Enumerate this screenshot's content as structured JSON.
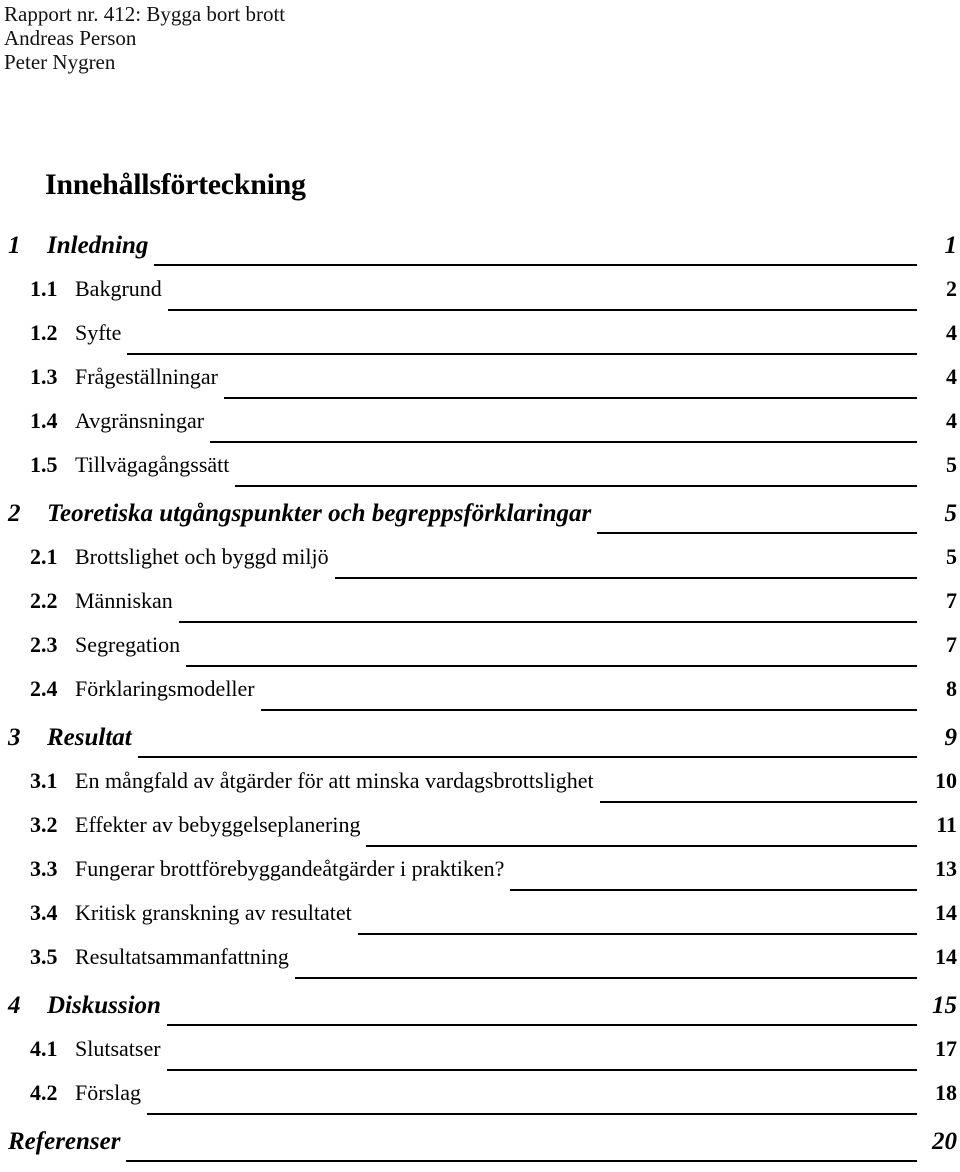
{
  "document": {
    "header_lines": [
      "Rapport nr. 412: Bygga bort brott",
      "Andreas Person",
      "Peter Nygren"
    ],
    "toc_heading": "Innehållsförteckning"
  },
  "toc": {
    "entries": [
      {
        "level": 1,
        "number": "1",
        "title": "Inledning",
        "page": "1"
      },
      {
        "level": 2,
        "number": "1.1",
        "title": "Bakgrund",
        "page": "2"
      },
      {
        "level": 2,
        "number": "1.2",
        "title": "Syfte",
        "page": "4"
      },
      {
        "level": 2,
        "number": "1.3",
        "title": "Frågeställningar",
        "page": "4"
      },
      {
        "level": 2,
        "number": "1.4",
        "title": "Avgränsningar",
        "page": "4"
      },
      {
        "level": 2,
        "number": "1.5",
        "title": "Tillvägagångssätt",
        "page": "5"
      },
      {
        "level": 1,
        "number": "2",
        "title": "Teoretiska utgångspunkter och begreppsförklaringar",
        "page": "5"
      },
      {
        "level": 2,
        "number": "2.1",
        "title": "Brottslighet och byggd miljö",
        "page": "5"
      },
      {
        "level": 2,
        "number": "2.2",
        "title": "Människan",
        "page": "7"
      },
      {
        "level": 2,
        "number": "2.3",
        "title": "Segregation",
        "page": "7"
      },
      {
        "level": 2,
        "number": "2.4",
        "title": "Förklaringsmodeller",
        "page": "8"
      },
      {
        "level": 1,
        "number": "3",
        "title": "Resultat",
        "page": "9"
      },
      {
        "level": 2,
        "number": "3.1",
        "title": "En mångfald av åtgärder för att minska vardagsbrottslighet",
        "page": "10"
      },
      {
        "level": 2,
        "number": "3.2",
        "title": "Effekter av bebyggelseplanering",
        "page": "11"
      },
      {
        "level": 2,
        "number": "3.3",
        "title": "Fungerar brottförebyggandeåtgärder i praktiken?",
        "page": "13"
      },
      {
        "level": 2,
        "number": "3.4",
        "title": "Kritisk granskning av resultatet",
        "page": "14"
      },
      {
        "level": 2,
        "number": "3.5",
        "title": "Resultatsammanfattning",
        "page": "14"
      },
      {
        "level": 1,
        "number": "4",
        "title": "Diskussion",
        "page": "15"
      },
      {
        "level": 2,
        "number": "4.1",
        "title": "Slutsatser",
        "page": "17"
      },
      {
        "level": 2,
        "number": "4.2",
        "title": "Förslag",
        "page": "18"
      },
      {
        "level": 1,
        "number": "",
        "title": "Referenser",
        "page": "20"
      }
    ]
  },
  "colors": {
    "page_background": "#ffffff",
    "text": "#000000",
    "leader_rule": "#000000"
  }
}
